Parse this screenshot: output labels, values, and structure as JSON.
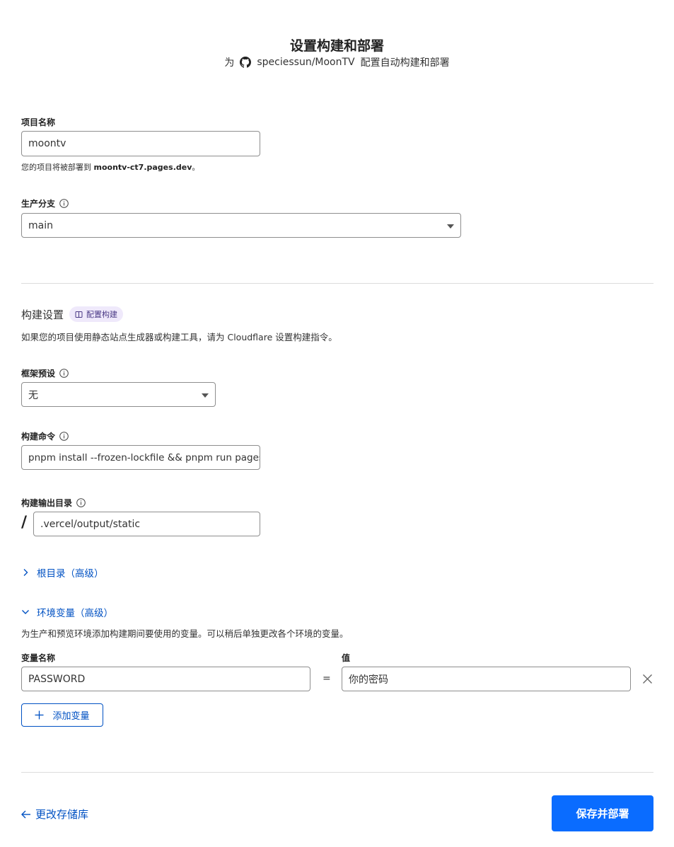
{
  "header": {
    "title": "设置构建和部署",
    "subtitle_prefix": "为",
    "repo": "speciessun/MoonTV",
    "subtitle_suffix": "配置自动构建和部署"
  },
  "project": {
    "label": "项目名称",
    "value": "moontv",
    "hint_prefix": "您的项目将被部署到",
    "hint_domain": "moontv-ct7.pages.dev",
    "hint_suffix": "。"
  },
  "branch": {
    "label": "生产分支",
    "value": "main"
  },
  "build": {
    "section_title": "构建设置",
    "badge": "配置构建",
    "description": "如果您的项目使用静态站点生成器或构建工具，请为 Cloudflare 设置构建指令。",
    "framework_label": "框架预设",
    "framework_value": "无",
    "command_label": "构建命令",
    "command_value": "pnpm install --frozen-lockfile && pnpm run pages:build",
    "output_label": "构建输出目录",
    "output_prefix": "/",
    "output_value": ".vercel/output/static",
    "root_dir_link": "根目录（高级）"
  },
  "env": {
    "link": "环境变量（高级）",
    "description": "为生产和预览环境添加构建期间要使用的变量。可以稍后单独更改各个环境的变量。",
    "name_label": "变量名称",
    "value_label": "值",
    "equals": "=",
    "rows": [
      {
        "name": "PASSWORD",
        "value": "你的密码"
      }
    ],
    "add_button": "添加变量"
  },
  "footer": {
    "back_link": "更改存储库",
    "submit_button": "保存并部署"
  },
  "colors": {
    "primary": "#0a6cff",
    "link": "#0051c3",
    "badge_bg": "#efe9fb"
  }
}
